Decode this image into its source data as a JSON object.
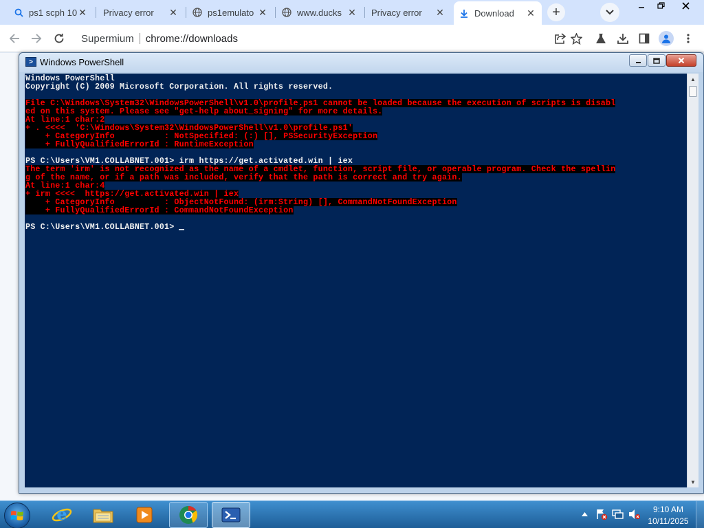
{
  "browser": {
    "tabs": [
      {
        "title": "ps1 scph 10",
        "icon": "search-icon"
      },
      {
        "title": "Privacy error",
        "icon": "none"
      },
      {
        "title": "ps1emulato",
        "icon": "globe-icon"
      },
      {
        "title": "www.ducks",
        "icon": "globe-icon"
      },
      {
        "title": "Privacy error",
        "icon": "none"
      },
      {
        "title": "Download",
        "icon": "download-icon"
      }
    ],
    "new_tab": "+",
    "omnibox": {
      "site": "Supermium",
      "url": "chrome://downloads"
    }
  },
  "powershell": {
    "title": "Windows PowerShell",
    "lines": [
      {
        "text": "Windows PowerShell",
        "type": "out"
      },
      {
        "text": "Copyright (C) 2009 Microsoft Corporation. All rights reserved.",
        "type": "out"
      },
      {
        "text": "",
        "type": "out"
      },
      {
        "text": "File C:\\Windows\\System32\\WindowsPowerShell\\v1.0\\profile.ps1 cannot be loaded because the execution of scripts is disabl",
        "type": "err"
      },
      {
        "text": "ed on this system. Please see \"get-help about_signing\" for more details.",
        "type": "err"
      },
      {
        "text": "At line:1 char:2",
        "type": "err"
      },
      {
        "text": "+ . <<<<  'C:\\Windows\\System32\\WindowsPowerShell\\v1.0\\profile.ps1'",
        "type": "err"
      },
      {
        "text": "    + CategoryInfo          : NotSpecified: (:) [], PSSecurityException",
        "type": "err"
      },
      {
        "text": "    + FullyQualifiedErrorId : RuntimeException",
        "type": "err"
      },
      {
        "text": "",
        "type": "out"
      },
      {
        "text": "PS C:\\Users\\VM1.COLLABNET.001> irm https://get.activated.win | iex",
        "type": "out"
      },
      {
        "text": "The term 'irm' is not recognized as the name of a cmdlet, function, script file, or operable program. Check the spellin",
        "type": "err"
      },
      {
        "text": "g of the name, or if a path was included, verify that the path is correct and try again.",
        "type": "err"
      },
      {
        "text": "At line:1 char:4",
        "type": "err"
      },
      {
        "text": "+ irm <<<<  https://get.activated.win | iex",
        "type": "err"
      },
      {
        "text": "    + CategoryInfo          : ObjectNotFound: (irm:String) [], CommandNotFoundException",
        "type": "err"
      },
      {
        "text": "    + FullyQualifiedErrorId : CommandNotFoundException",
        "type": "err"
      },
      {
        "text": "",
        "type": "out"
      },
      {
        "text": "PS C:\\Users\\VM1.COLLABNET.001>",
        "type": "prompt"
      }
    ]
  },
  "taskbar": {
    "apps": [
      "internet-explorer",
      "windows-explorer",
      "media-player",
      "chrome-browser",
      "powershell"
    ],
    "clock": {
      "time": "9:10 AM",
      "date": "10/11/2025"
    }
  },
  "colors": {
    "console_bg": "#012456",
    "console_text": "#f0f0f0",
    "error_text": "#ff0000",
    "error_bg": "#000000",
    "tabstrip": "#d3e3fd",
    "taskbar": "#2a74b3"
  }
}
